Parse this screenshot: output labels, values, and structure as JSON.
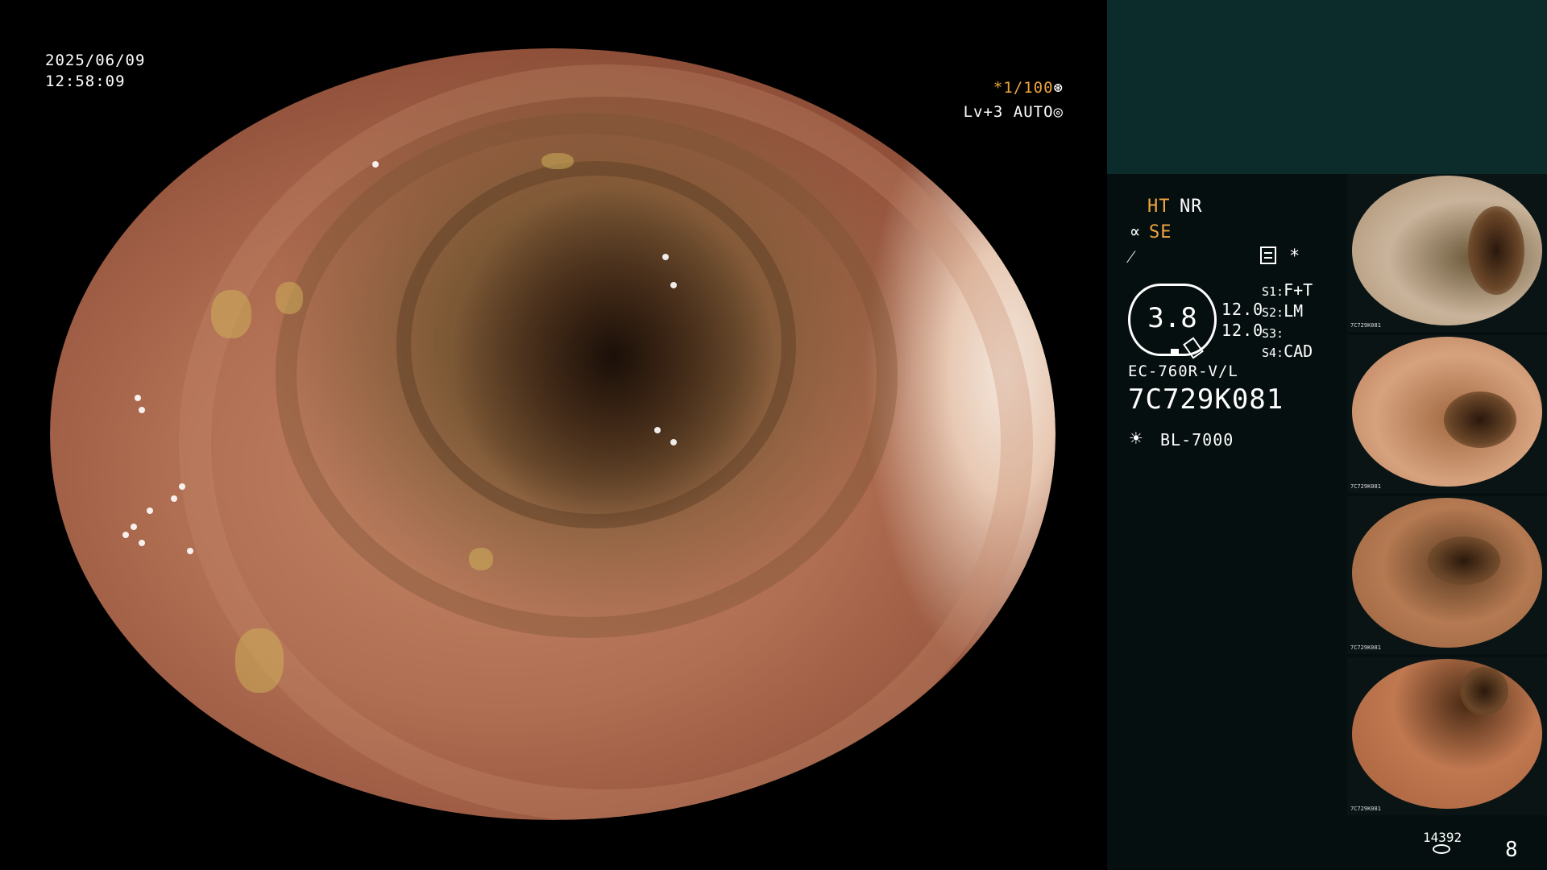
{
  "overlay": {
    "date": "2025/06/09",
    "time": "12:58:09",
    "shutter": "*1/100",
    "shutter_icon": "aperture-icon",
    "level": "Lv+3 AUTO",
    "level_icon": "auto-icon"
  },
  "panel": {
    "ht": "HT",
    "nr": "NR",
    "se_icon": "∝",
    "se": "SE",
    "enhance_icon": "⁄",
    "asterisk": "*",
    "gauge_value": "3.8",
    "value_1": "12.0",
    "value_2": "12.0",
    "switches": [
      {
        "key": "S1:",
        "value": "F+T"
      },
      {
        "key": "S2:",
        "value": "LM"
      },
      {
        "key": "S3:",
        "value": ""
      },
      {
        "key": "S4:",
        "value": "CAD"
      }
    ],
    "scope_model": "EC-760R-V/L",
    "scope_serial": "7C729K081",
    "light_icon": "☀",
    "light_model": "BL-7000",
    "counter": "14392",
    "page_number": "8"
  },
  "thumbnails": [
    {
      "label": "7C729K081"
    },
    {
      "label": "7C729K081"
    },
    {
      "label": "7C729K081"
    },
    {
      "label": "7C729K081"
    }
  ],
  "colors": {
    "accent": "#f0a640",
    "panel_top": "#0c2b2b",
    "panel_bg": "#060f0f"
  }
}
